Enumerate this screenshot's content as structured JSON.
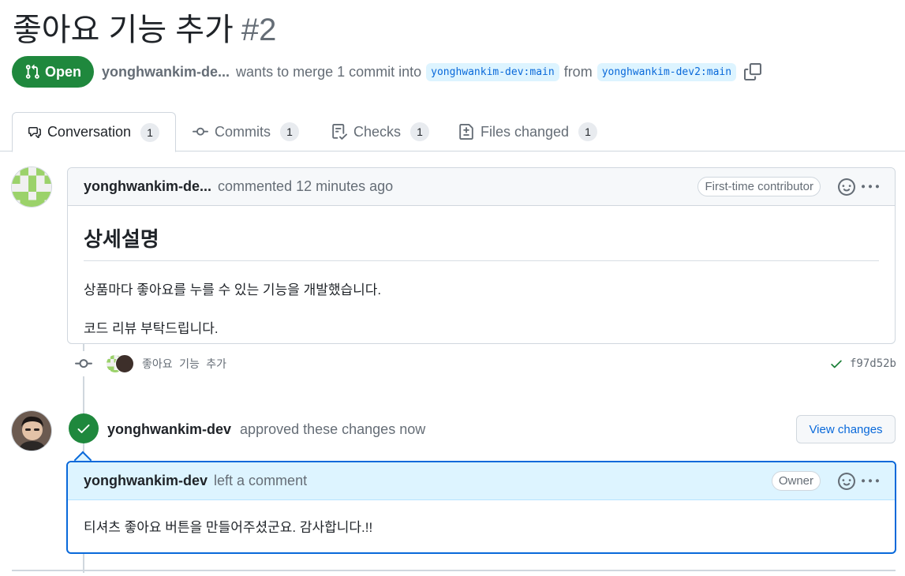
{
  "pr": {
    "title": "좋아요 기능 추가",
    "number": "#2",
    "state": "Open",
    "author": "yonghwankim-de...",
    "merge_text": "wants to merge 1 commit into",
    "base_branch": "yonghwankim-dev:main",
    "from_text": "from",
    "head_branch": "yonghwankim-dev2:main"
  },
  "tabs": [
    {
      "label": "Conversation",
      "count": "1",
      "icon": "comment-discussion-icon",
      "active": true
    },
    {
      "label": "Commits",
      "count": "1",
      "icon": "git-commit-icon"
    },
    {
      "label": "Checks",
      "count": "1",
      "icon": "checklist-icon"
    },
    {
      "label": "Files changed",
      "count": "1",
      "icon": "file-diff-icon"
    }
  ],
  "first_comment": {
    "author": "yonghwankim-de...",
    "action": "commented 12 minutes ago",
    "badge": "First-time contributor",
    "heading": "상세설명",
    "paragraphs": [
      "상품마다 좋아요를 누를 수 있는 기능을 개발했습니다.",
      "코드 리뷰 부탁드립니다."
    ]
  },
  "commit": {
    "message": "좋아요 기능 추가",
    "sha": "f97d52b"
  },
  "review": {
    "author": "yonghwankim-dev",
    "action": "approved these changes now",
    "view_button": "View changes",
    "comment_author": "yonghwankim-dev",
    "comment_action": "left a comment",
    "badge": "Owner",
    "body": "티셔츠 좋아요 버튼을 만들어주셨군요. 감사합니다.!!"
  },
  "colors": {
    "open_green": "#1f883d",
    "link_blue": "#0969da",
    "branch_bg": "#ddf4ff",
    "identicon_green": "#9bd26a"
  }
}
